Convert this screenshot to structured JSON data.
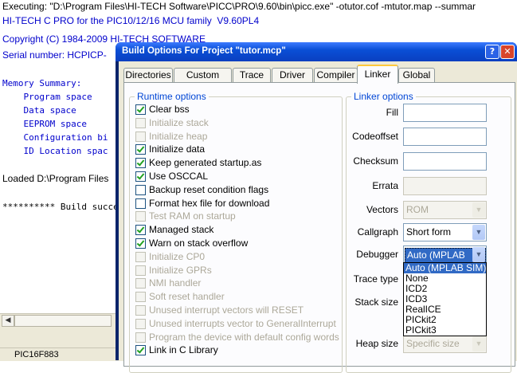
{
  "output": {
    "lines": [
      "Executing: \"D:\\Program Files\\HI-TECH Software\\PICC\\PRO\\9.60\\bin\\picc.exe\" -otutor.cof -mtutor.map --summar",
      "HI-TECH C PRO for the PIC10/12/16 MCU family  V9.60PL4",
      "Copyright (C) 1984-2009 HI-TECH SOFTWARE",
      "Serial number: HCPICP-",
      "Memory Summary:",
      "    Program space",
      "    Data space",
      "    EEPROM space",
      "    Configuration bi",
      "    ID Location spac",
      "Loaded D:\\Program Files",
      "********** Build succes"
    ],
    "status_device": "PIC16F883"
  },
  "dialog": {
    "title": "Build Options For Project \"tutor.mcp\"",
    "help_glyph": "?",
    "close_glyph": "✕",
    "tabs": [
      "Directories",
      "Custom Build",
      "Trace",
      "Driver",
      "Compiler",
      "Linker",
      "Global"
    ],
    "active_tab": "Linker"
  },
  "runtime": {
    "title": "Runtime options",
    "options": [
      {
        "label": "Clear bss",
        "checked": true,
        "enabled": true
      },
      {
        "label": "Initialize stack",
        "checked": false,
        "enabled": false
      },
      {
        "label": "Initialize heap",
        "checked": false,
        "enabled": false
      },
      {
        "label": "Initialize data",
        "checked": true,
        "enabled": true
      },
      {
        "label": "Keep generated startup.as",
        "checked": true,
        "enabled": true
      },
      {
        "label": "Use OSCCAL",
        "checked": true,
        "enabled": true
      },
      {
        "label": "Backup reset condition flags",
        "checked": false,
        "enabled": true
      },
      {
        "label": "Format hex file for download",
        "checked": false,
        "enabled": true
      },
      {
        "label": "Test RAM on startup",
        "checked": false,
        "enabled": false
      },
      {
        "label": "Managed stack",
        "checked": true,
        "enabled": true
      },
      {
        "label": "Warn on stack overflow",
        "checked": true,
        "enabled": true
      },
      {
        "label": "Initialize CP0",
        "checked": false,
        "enabled": false
      },
      {
        "label": "Initialize GPRs",
        "checked": false,
        "enabled": false
      },
      {
        "label": "NMI handler",
        "checked": false,
        "enabled": false
      },
      {
        "label": "Soft reset handler",
        "checked": false,
        "enabled": false
      },
      {
        "label": "Unused interrupt vectors will RESET",
        "checked": false,
        "enabled": false
      },
      {
        "label": "Unused interrupts vector to GeneralInterrupt",
        "checked": false,
        "enabled": false
      },
      {
        "label": "Program the device with default config words",
        "checked": false,
        "enabled": false
      },
      {
        "label": "Link in C Library",
        "checked": true,
        "enabled": true
      }
    ]
  },
  "linker": {
    "title": "Linker options",
    "fill_label": "Fill",
    "codeoffset_label": "Codeoffset",
    "checksum_label": "Checksum",
    "errata_label": "Errata",
    "vectors_label": "Vectors",
    "vectors_value": "ROM",
    "callgraph_label": "Callgraph",
    "callgraph_value": "Short form",
    "debugger_label": "Debugger",
    "debugger_value": "Auto (MPLAB SIM)",
    "debugger_options": [
      "Auto (MPLAB SIM)",
      "None",
      "ICD2",
      "ICD3",
      "RealICE",
      "PICkit2",
      "PICkit3"
    ],
    "trace_type_label": "Trace type",
    "stack_size_label": "Stack size",
    "heap_size_label": "Heap size",
    "heap_size_value": "Specific size"
  },
  "icons": {
    "dropdown_arrow": "▼",
    "scroll_left": "◀"
  },
  "colors": {
    "titlebar": "#0a4fd6",
    "group_title": "#0046d5",
    "selection": "#316ac5",
    "output_blue": "#0000cc"
  }
}
